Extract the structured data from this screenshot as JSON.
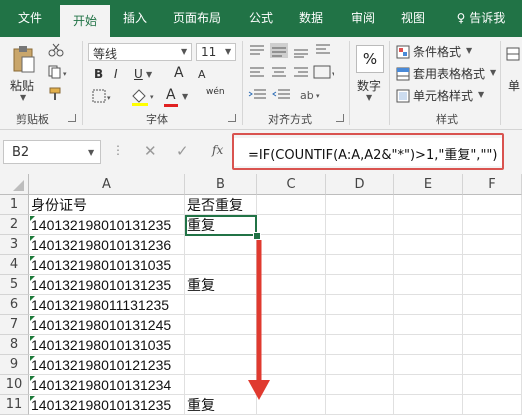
{
  "ribbon": {
    "tabs": [
      "文件",
      "开始",
      "插入",
      "页面布局",
      "公式",
      "数据",
      "审阅",
      "视图"
    ],
    "tell_me": "告诉我",
    "clipboard": {
      "paste": "粘贴",
      "label": "剪贴板"
    },
    "font": {
      "name": "等线",
      "size": "11",
      "bold": "B",
      "italic": "I",
      "underline": "U",
      "grow": "A",
      "shrink": "A",
      "color_letter": "A",
      "wen": "wén",
      "label": "字体"
    },
    "alignment": {
      "label": "对齐方式"
    },
    "number": {
      "symbol": "%",
      "label": "数字"
    },
    "styles": {
      "conditional": "条件格式",
      "table": "套用表格格式",
      "cell": "单元格样式",
      "label": "样式"
    },
    "cells_partial": "单"
  },
  "formula_bar": {
    "name_box": "B2",
    "fx": "fx",
    "formula": "=IF(COUNTIF(A:A,A2&\"*\")>1,\"重复\",\"\")"
  },
  "sheet": {
    "columns": [
      "A",
      "B",
      "C",
      "D",
      "E",
      "F"
    ],
    "rows": [
      {
        "n": "1",
        "a": "身份证号",
        "b": "是否重复"
      },
      {
        "n": "2",
        "a": "140132198010131235",
        "b": "重复"
      },
      {
        "n": "3",
        "a": "140132198010131236",
        "b": ""
      },
      {
        "n": "4",
        "a": "140132198010131035",
        "b": ""
      },
      {
        "n": "5",
        "a": "140132198010131235",
        "b": "重复"
      },
      {
        "n": "6",
        "a": "140132198011131235",
        "b": ""
      },
      {
        "n": "7",
        "a": "140132198010131245",
        "b": ""
      },
      {
        "n": "8",
        "a": "140132198010131035",
        "b": ""
      },
      {
        "n": "9",
        "a": "140132198010121235",
        "b": ""
      },
      {
        "n": "10",
        "a": "140132198010131234",
        "b": ""
      },
      {
        "n": "11",
        "a": "140132198010131235",
        "b": "重复"
      }
    ]
  },
  "colors": {
    "brand": "#217346",
    "highlight": "#d9534f",
    "arrow": "#e03a2f"
  }
}
